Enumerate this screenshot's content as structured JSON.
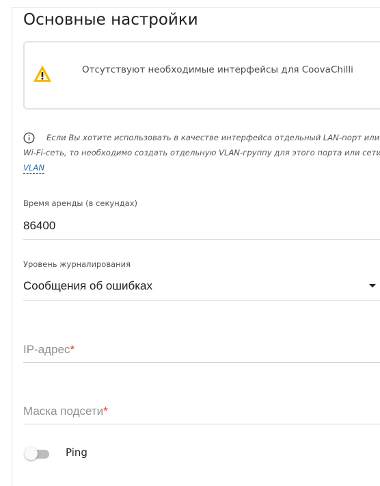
{
  "section": {
    "title": "Основные настройки"
  },
  "warning": {
    "icon": "warning-icon",
    "text": "Отсутствуют необходимые интерфейсы для CoovaChilli",
    "accent": "#f5b800"
  },
  "info": {
    "icon": "info-icon",
    "text": "Если Вы хотите использовать в качестве интерфейса отдельный LAN-порт или Wi-Fi-сеть, то необходимо создать отдельную VLAN-группу для этого порта или сети",
    "link_label": "VLAN",
    "link_color": "#1f6fbf"
  },
  "lease_time": {
    "label": "Время аренды (в секундах)",
    "value": "86400"
  },
  "log_level": {
    "label": "Уровень журналирования",
    "selected": "Сообщения об ошибках",
    "icon": "caret-down-icon"
  },
  "ip_address": {
    "placeholder": "IP-адрес",
    "required_mark": "*"
  },
  "subnet_mask": {
    "placeholder": "Маска подсети",
    "required_mark": "*"
  },
  "ping": {
    "label": "Ping",
    "enabled": false
  },
  "colors": {
    "required": "#e53935",
    "divider": "#d4d4d4"
  }
}
